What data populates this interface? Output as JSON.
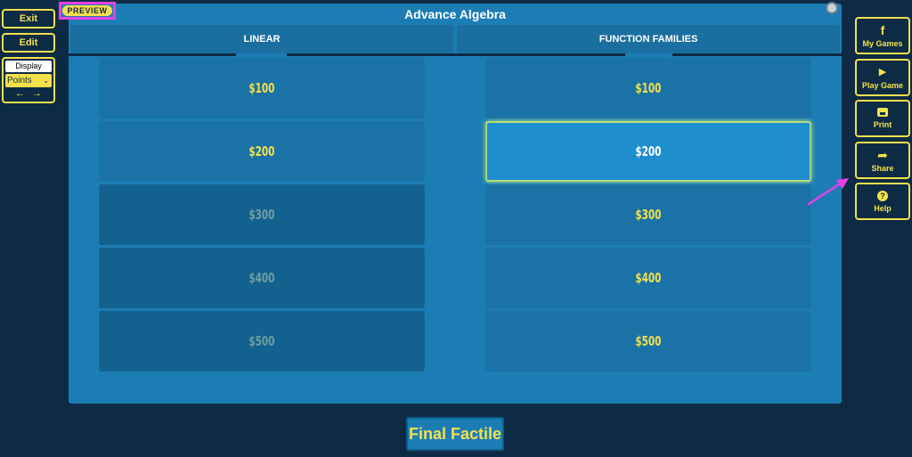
{
  "left": {
    "exit_label": "Exit",
    "edit_label": "Edit",
    "display_label": "Display",
    "display_value": "Points",
    "prev_arrow": "←",
    "next_arrow": "→"
  },
  "board": {
    "preview_label": "PREVIEW",
    "title": "Advance Algebra",
    "categories": [
      {
        "name": "LINEAR",
        "tiles": [
          {
            "label": "$100",
            "state": "available"
          },
          {
            "label": "$200",
            "state": "available"
          },
          {
            "label": "$300",
            "state": "used"
          },
          {
            "label": "$400",
            "state": "used"
          },
          {
            "label": "$500",
            "state": "used"
          }
        ]
      },
      {
        "name": "FUNCTION FAMILIES",
        "tiles": [
          {
            "label": "$100",
            "state": "available"
          },
          {
            "label": "$200",
            "state": "hover"
          },
          {
            "label": "$300",
            "state": "available"
          },
          {
            "label": "$400",
            "state": "available"
          },
          {
            "label": "$500",
            "state": "available"
          }
        ]
      }
    ]
  },
  "right": {
    "my_games": {
      "label": "My Games",
      "icon": "facebook-f-icon",
      "glyph": "f"
    },
    "play_game": {
      "label": "Play Game",
      "icon": "play-icon",
      "glyph": "▶"
    },
    "print": {
      "label": "Print",
      "icon": "printer-icon"
    },
    "share": {
      "label": "Share",
      "icon": "share-arrow-icon",
      "glyph": "➦"
    },
    "help": {
      "label": "Help",
      "icon": "question-icon",
      "glyph": "?"
    }
  },
  "final_label": "Final Factile",
  "colors": {
    "background": "#0d2b44",
    "board": "#1c7db5",
    "accent_yellow": "#f4e04d",
    "annotation_magenta": "#e83fe8"
  }
}
